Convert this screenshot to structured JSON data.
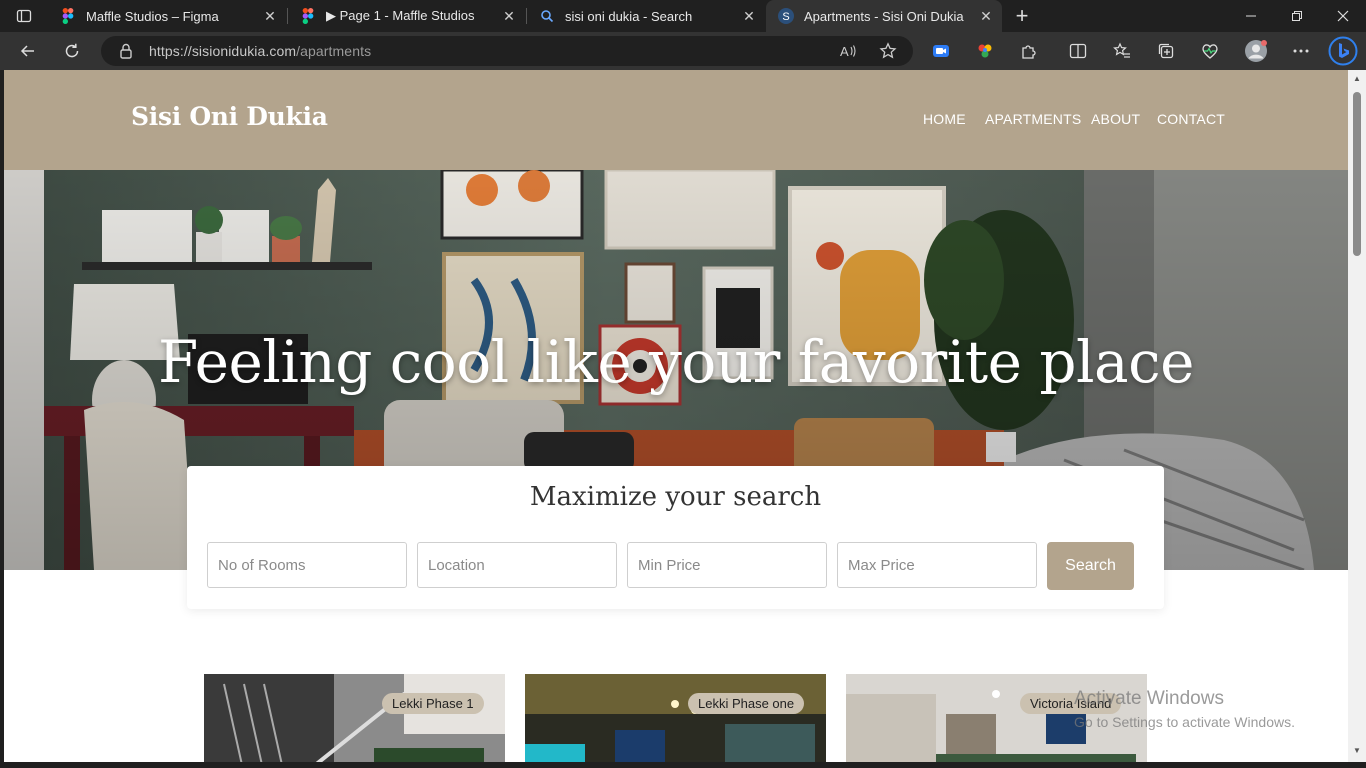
{
  "browser": {
    "tabs": [
      {
        "title": "Maffle Studios – Figma",
        "icon": "figma-icon"
      },
      {
        "title": "▶ Page 1 - Maffle Studios",
        "icon": "figma-icon"
      },
      {
        "title": "sisi oni dukia - Search",
        "icon": "search-icon"
      },
      {
        "title": "Apartments - Sisi Oni Dukia",
        "icon": "site-s-icon"
      }
    ],
    "address": {
      "prefix": "https://",
      "host": "sisionidukia.com",
      "path": "/apartments"
    }
  },
  "site": {
    "brand": "Sisi Oni Dukia",
    "nav": [
      "HOME",
      "APARTMENTS",
      "ABOUT",
      "CONTACT"
    ],
    "hero_title": "Feeling cool like your favorite place",
    "search": {
      "title": "Maximize your search",
      "rooms_placeholder": "No of Rooms",
      "location_placeholder": "Location",
      "min_price_placeholder": "Min Price",
      "max_price_placeholder": "Max Price",
      "button": "Search"
    },
    "listings": [
      {
        "location": "Lekki Phase 1"
      },
      {
        "location": "Lekki Phase one"
      },
      {
        "location": "Victoria Island"
      }
    ]
  },
  "os": {
    "watermark_title": "Activate Windows",
    "watermark_sub": "Go to Settings to activate Windows."
  },
  "colors": {
    "brand": "#b3a48d",
    "tab_active": "#333333",
    "chrome": "#202020"
  }
}
